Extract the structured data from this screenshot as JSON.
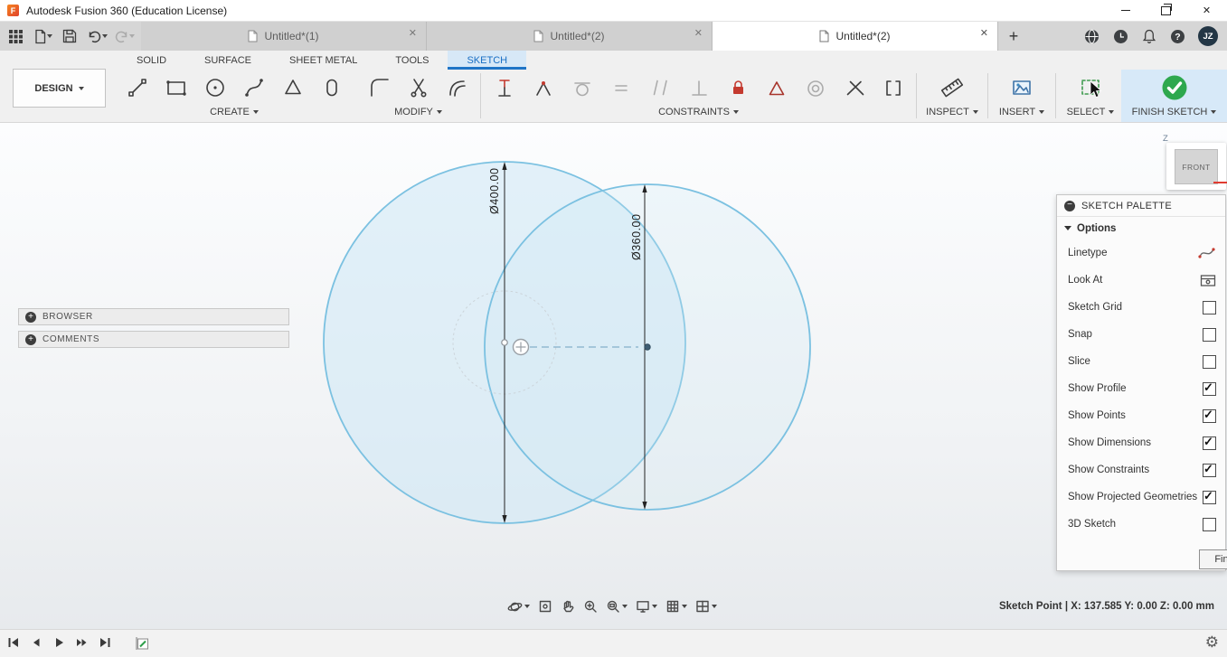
{
  "colors": {
    "sketch_tab_blue": "#1a6fc4",
    "finish_green": "#2ea84e",
    "circle_stroke": "#7bc1e1",
    "lock_red": "#c43a2f",
    "select_dash_green": "#3f9b4f"
  },
  "titlebar": {
    "title": "Autodesk Fusion 360 (Education License)",
    "window_icons": [
      "minimize-icon",
      "maximize-icon",
      "close-icon"
    ]
  },
  "tabbar": {
    "quick_icons": [
      "apps-grid-icon",
      "file-icon",
      "save-icon",
      "undo-icon",
      "redo-icon"
    ],
    "tabs": [
      {
        "label": "Untitled*(1)"
      },
      {
        "label": "Untitled*(2)"
      },
      {
        "label": "Untitled*(2)"
      }
    ],
    "active_tab_index": 2,
    "right_icons": [
      "globe-icon",
      "job-status-icon",
      "notifications-bell-icon",
      "help-icon"
    ],
    "avatar_initials": "JZ"
  },
  "ribbon": {
    "workspace": "DESIGN",
    "tabs": [
      {
        "label": "SOLID"
      },
      {
        "label": "SURFACE"
      },
      {
        "label": "SHEET METAL"
      },
      {
        "label": "TOOLS"
      },
      {
        "label": "SKETCH"
      }
    ],
    "active_tab_index": 4,
    "groups": {
      "create": "CREATE",
      "modify": "MODIFY",
      "constraints": "CONSTRAINTS",
      "inspect": "INSPECT",
      "insert": "INSERT",
      "select": "SELECT",
      "finish": "FINISH SKETCH"
    },
    "create_icons": [
      "line-tool-icon",
      "rectangle-tool-icon",
      "circle-tool-icon",
      "spline-tool-icon",
      "polygon-tool-icon",
      "slot-tool-icon"
    ],
    "modify_icons": [
      "fillet-tool-icon",
      "trim-tool-icon",
      "offset-tool-icon"
    ],
    "constraint_icons": [
      "horizontal-vertical-constraint-icon",
      "coincident-constraint-icon",
      "tangent-constraint-icon",
      "equal-constraint-icon",
      "parallel-constraint-icon",
      "perpendicular-constraint-icon",
      "fix-constraint-icon",
      "midpoint-constraint-icon",
      "concentric-constraint-icon",
      "collinear-constraint-icon",
      "symmetry-constraint-icon"
    ]
  },
  "panels": {
    "browser": "BROWSER",
    "comments": "COMMENTS"
  },
  "viewcube": {
    "face": "FRONT",
    "axis_z": "Z"
  },
  "sketch": {
    "dim_outer": "Ø400.00",
    "dim_inner": "Ø360.00"
  },
  "palette": {
    "title": "SKETCH PALETTE",
    "section": "Options",
    "rows": [
      {
        "label": "Linetype",
        "control": "icon"
      },
      {
        "label": "Look At",
        "control": "icon"
      },
      {
        "label": "Sketch Grid",
        "control": "checkbox",
        "checked": false
      },
      {
        "label": "Snap",
        "control": "checkbox",
        "checked": false
      },
      {
        "label": "Slice",
        "control": "checkbox",
        "checked": false
      },
      {
        "label": "Show Profile",
        "control": "checkbox",
        "checked": true
      },
      {
        "label": "Show Points",
        "control": "checkbox",
        "checked": true
      },
      {
        "label": "Show Dimensions",
        "control": "checkbox",
        "checked": true
      },
      {
        "label": "Show Constraints",
        "control": "checkbox",
        "checked": true
      },
      {
        "label": "Show Projected Geometries",
        "control": "checkbox",
        "checked": true
      },
      {
        "label": "3D Sketch",
        "control": "checkbox",
        "checked": false
      }
    ],
    "finish_button": "Finish"
  },
  "navbar_icons": [
    "orbit-icon",
    "look-at-icon",
    "pan-icon",
    "zoom-icon",
    "fit-icon",
    "display-settings-icon",
    "grid-settings-icon",
    "viewports-icon"
  ],
  "timeline_icons": [
    "go-to-start-icon",
    "step-back-icon",
    "play-icon",
    "step-forward-icon",
    "go-to-end-icon",
    "sketch-feature-icon"
  ],
  "statusbar": {
    "text": "Sketch Point | X: 137.585 Y: 0.00 Z: 0.00 mm"
  }
}
